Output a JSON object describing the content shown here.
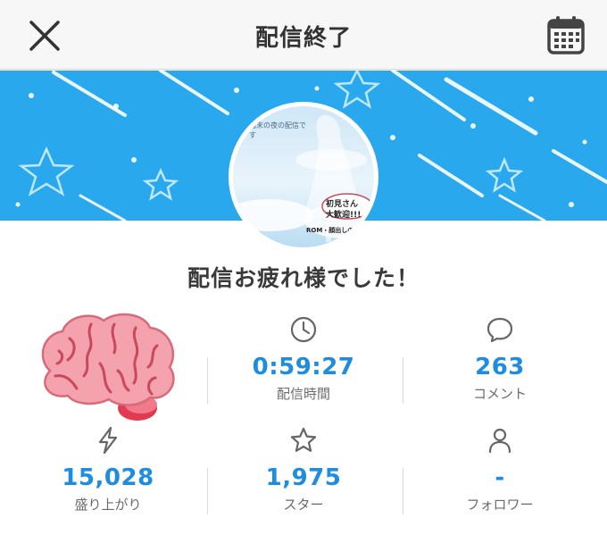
{
  "header": {
    "title": "配信終了",
    "close_icon": "close-icon",
    "calendar_icon": "calendar-icon"
  },
  "message": "配信お疲れ様でした！",
  "avatar": {
    "text_top": "週末の夜の配信です",
    "badge_line1": "初見さん",
    "badge_line2": "大歓迎!!!",
    "footer": "ROM・顔出しのみ ▶ OK"
  },
  "stats": {
    "duration": {
      "icon": "clock-icon",
      "value": "0:59:27",
      "label": "配信時間"
    },
    "comments": {
      "icon": "comment-icon",
      "value": "263",
      "label": "コメント"
    },
    "excitement": {
      "icon": "lightning-icon",
      "value": "15,028",
      "label": "盛り上がり"
    },
    "stars": {
      "icon": "star-icon",
      "value": "1,975",
      "label": "スター"
    },
    "followers": {
      "icon": "person-icon",
      "value": "-",
      "label": "フォロワー"
    }
  },
  "colors": {
    "banner": "#29a8ee",
    "accent_value": "#1c8de0",
    "header_bg": "#f7f7f7",
    "brain": "#f2a1a8"
  }
}
